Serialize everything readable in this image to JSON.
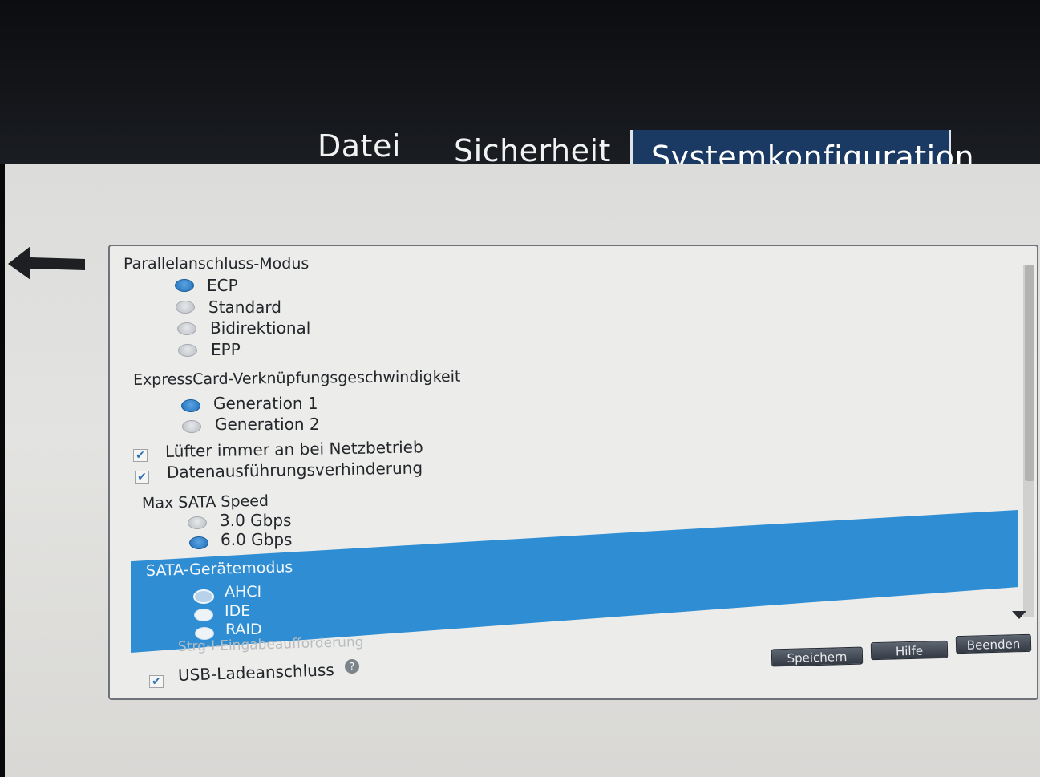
{
  "tabs": {
    "file": "Datei",
    "security": "Sicherheit",
    "system": "Systemkonfiguration"
  },
  "parallel": {
    "heading": "Parallelanschluss-Modus",
    "options": [
      "ECP",
      "Standard",
      "Bidirektional",
      "EPP"
    ],
    "selected": "ECP"
  },
  "expresscard": {
    "heading": "ExpressCard-Verknüpfungsgeschwindigkeit",
    "options": [
      "Generation 1",
      "Generation 2"
    ],
    "selected": "Generation 1"
  },
  "checks": {
    "fan": "Lüfter immer an bei Netzbetrieb",
    "dep": "Datenausführungsverhinderung"
  },
  "sata_speed": {
    "heading": "Max SATA Speed",
    "options": [
      "3.0 Gbps",
      "6.0 Gbps"
    ],
    "selected": "6.0 Gbps"
  },
  "sata_mode": {
    "heading": "SATA-Gerätemodus",
    "options": [
      "AHCI",
      "IDE",
      "RAID"
    ],
    "selected": "AHCI"
  },
  "faded_item": "Strg-I-Eingabeaufforderung",
  "usb": "USB-Ladeanschluss",
  "buttons": {
    "save": "Speichern",
    "help": "Hilfe",
    "exit": "Beenden"
  },
  "icons": {
    "back": "back-arrow-icon",
    "help": "question-icon",
    "scroll_down": "triangle-down-icon"
  },
  "colors": {
    "highlight": "#2f8ed3",
    "active_tab": "#1b3a63"
  }
}
